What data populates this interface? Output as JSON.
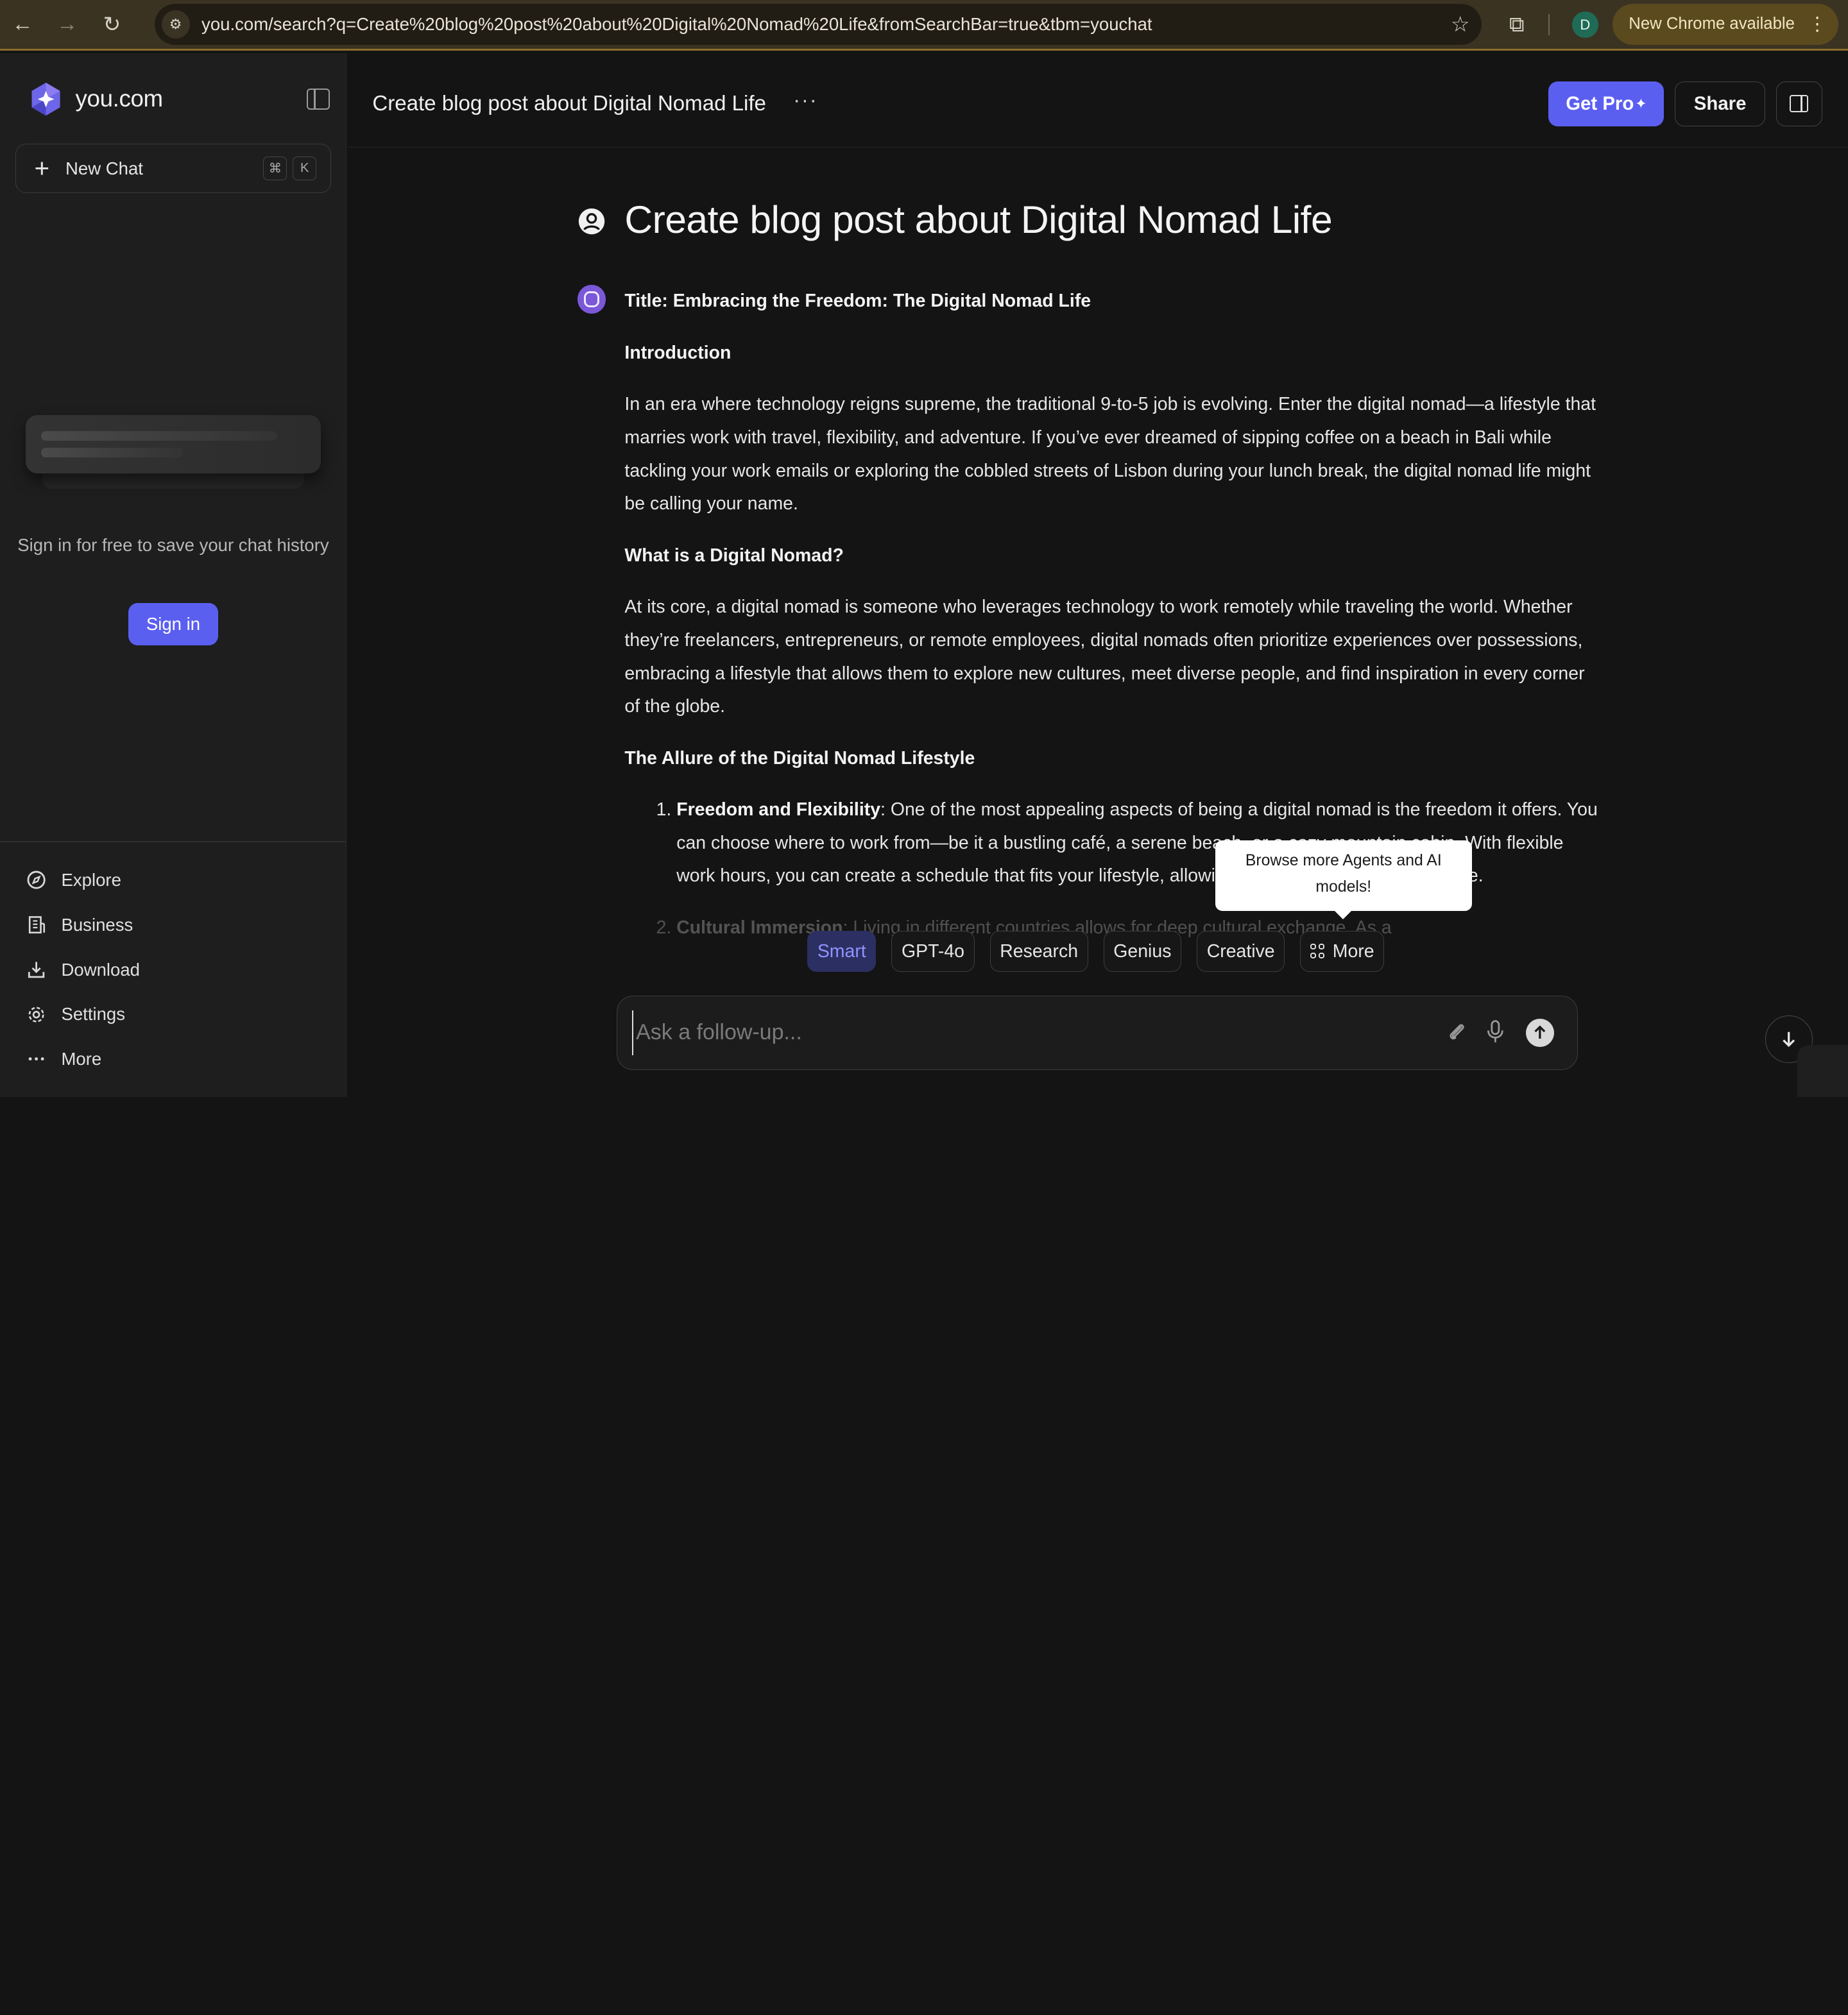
{
  "browser": {
    "url": "you.com/search?q=Create%20blog%20post%20about%20Digital%20Nomad%20Life&fromSearchBar=true&tbm=youchat",
    "profile_initial": "D",
    "update_label": "New Chrome available"
  },
  "sidebar": {
    "brand": "you.com",
    "new_chat_label": "New Chat",
    "shortcut_keys": [
      "⌘",
      "K"
    ],
    "signin_prompt": "Sign in for free to save your chat history",
    "signin_label": "Sign in",
    "nav": [
      {
        "label": "Explore",
        "icon": "compass-icon"
      },
      {
        "label": "Business",
        "icon": "building-icon"
      },
      {
        "label": "Download",
        "icon": "download-icon"
      },
      {
        "label": "Settings",
        "icon": "gear-icon"
      },
      {
        "label": "More",
        "icon": "more-dots-icon"
      }
    ]
  },
  "header": {
    "chat_title": "Create blog post about Digital Nomad Life",
    "get_pro_label": "Get Pro",
    "share_label": "Share"
  },
  "conversation": {
    "query": "Create blog post about Digital Nomad Life",
    "answer": {
      "title": "Title: Embracing the Freedom: The Digital Nomad Life",
      "intro_heading": "Introduction",
      "intro_text": "In an era where technology reigns supreme, the traditional 9-to-5 job is evolving. Enter the digital nomad—a lifestyle that marries work with travel, flexibility, and adventure. If you’ve ever dreamed of sipping coffee on a beach in Bali while tackling your work emails or exploring the cobbled streets of Lisbon during your lunch break, the digital nomad life might be calling your name.",
      "what_heading": "What is a Digital Nomad?",
      "what_text": "At its core, a digital nomad is someone who leverages technology to work remotely while traveling the world. Whether they’re freelancers, entrepreneurs, or remote employees, digital nomads often prioritize experiences over possessions, embracing a lifestyle that allows them to explore new cultures, meet diverse people, and find inspiration in every corner of the globe.",
      "allure_heading": "The Allure of the Digital Nomad Lifestyle",
      "list": [
        {
          "term": "Freedom and Flexibility",
          "text": ": One of the most appealing aspects of being a digital nomad is the freedom it offers. You can choose where to work from—be it a bustling café, a serene beach, or a cozy mountain cabin. With flexible work hours, you can create a schedule that fits your lifestyle, allowing for exploration and adventure."
        },
        {
          "term": "Cultural Immersion",
          "text": ": Living in different countries allows for deep cultural exchange. As a"
        }
      ]
    }
  },
  "models": {
    "chips": [
      "Smart",
      "GPT-4o",
      "Research",
      "Genius",
      "Creative"
    ],
    "active": "Smart",
    "more_label": "More",
    "tooltip": "Browse more Agents and AI models!"
  },
  "composer": {
    "placeholder": "Ask a follow-up..."
  }
}
